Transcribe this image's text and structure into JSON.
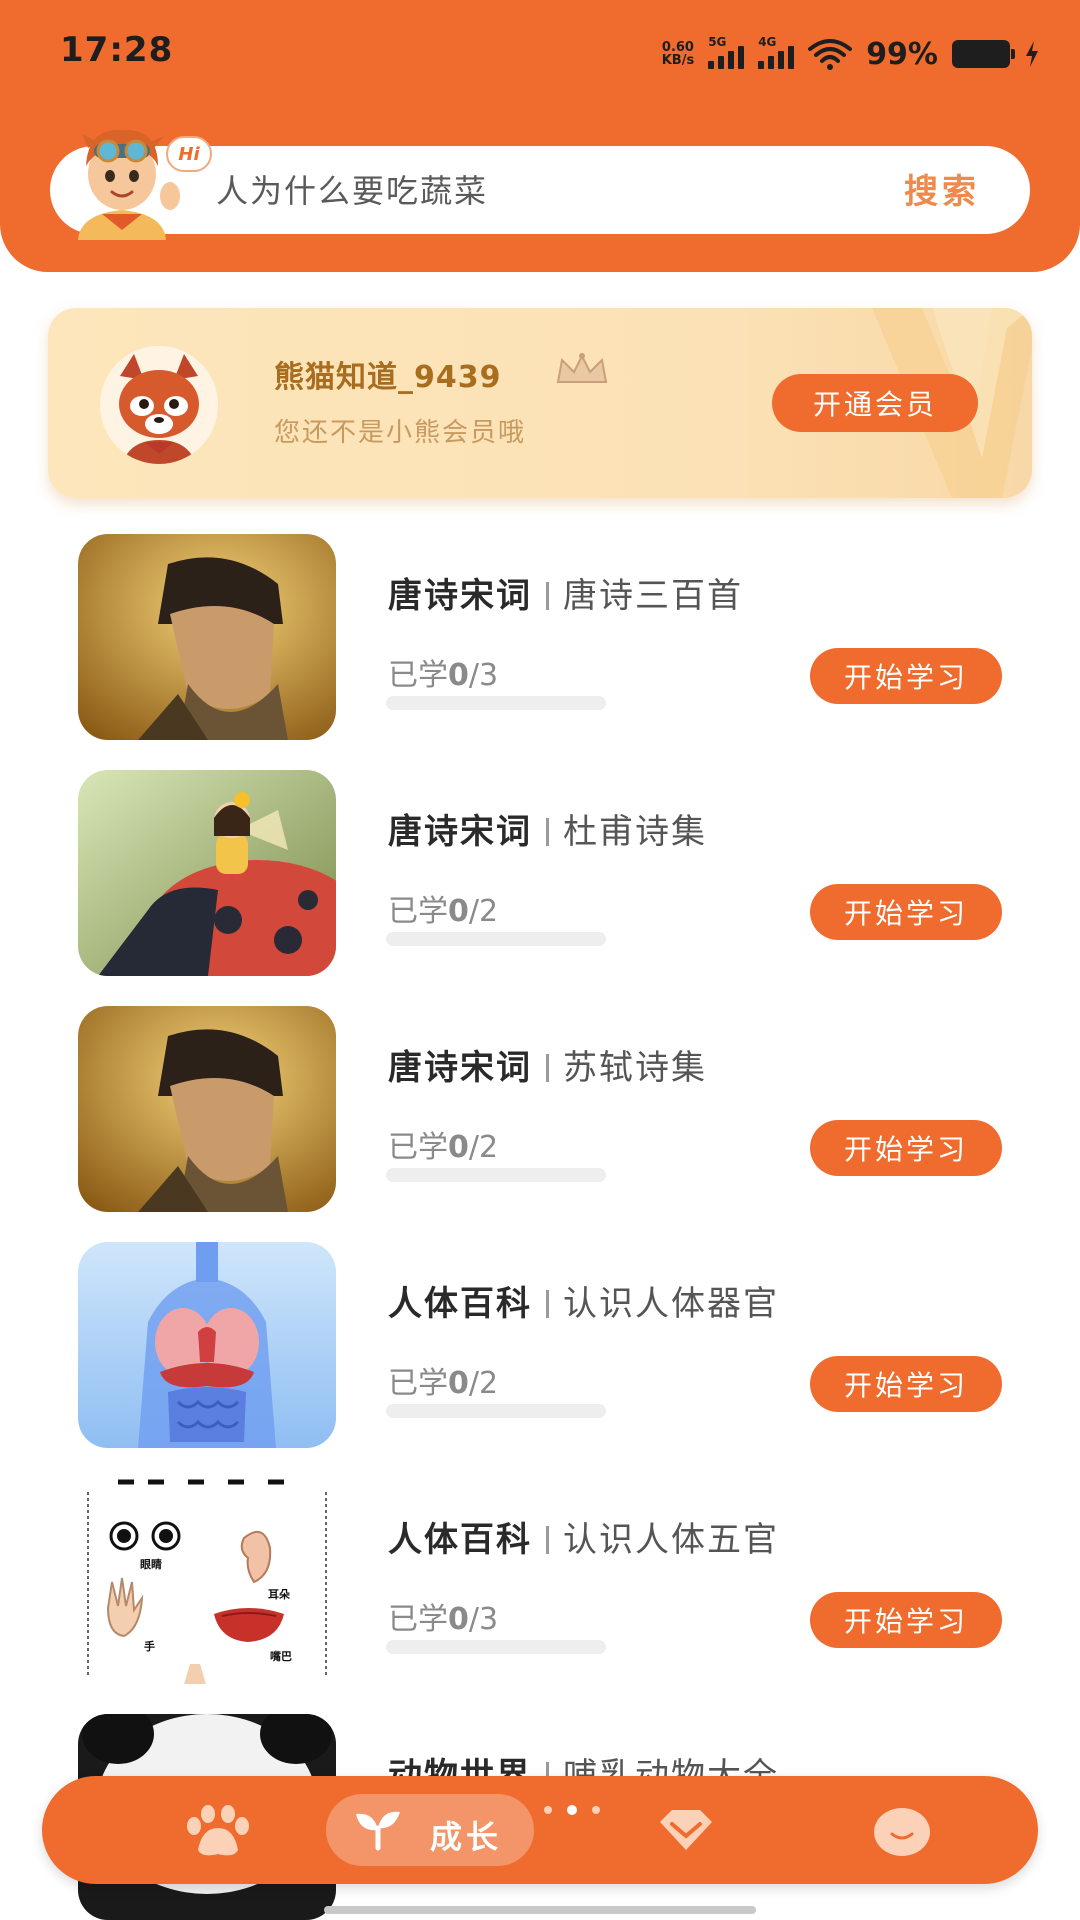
{
  "status_bar": {
    "time": "17:28",
    "net_speed_value": "0.60",
    "net_speed_unit": "KB/s",
    "sig1_label": "5G",
    "sig2_label": "4G",
    "battery_percent": "99%"
  },
  "search": {
    "hi_label": "Hi",
    "query": "人为什么要吃蔬菜",
    "button_label": "搜索"
  },
  "member": {
    "username": "熊猫知道_9439",
    "status": "您还不是小熊会员哦",
    "join_label": "开通会员"
  },
  "courses": [
    {
      "category": "唐诗宋词",
      "title": "唐诗三百首",
      "progress_label": "已学",
      "learned": "0",
      "total": "/3",
      "fraction": 0.0,
      "button": "开始学习",
      "thumb": "poet-portrait"
    },
    {
      "category": "唐诗宋词",
      "title": "杜甫诗集",
      "progress_label": "已学",
      "learned": "0",
      "total": "/2",
      "fraction": 0.0,
      "button": "开始学习",
      "thumb": "girl-on-ladybug"
    },
    {
      "category": "唐诗宋词",
      "title": "苏轼诗集",
      "progress_label": "已学",
      "learned": "0",
      "total": "/2",
      "fraction": 0.0,
      "button": "开始学习",
      "thumb": "poet-portrait"
    },
    {
      "category": "人体百科",
      "title": "认识人体器官",
      "progress_label": "已学",
      "learned": "0",
      "total": "/2",
      "fraction": 0.0,
      "button": "开始学习",
      "thumb": "human-anatomy"
    },
    {
      "category": "人体百科",
      "title": "认识人体五官",
      "progress_label": "已学",
      "learned": "0",
      "total": "/3",
      "fraction": 0.0,
      "button": "开始学习",
      "thumb": "five-senses-chart"
    },
    {
      "category": "动物世界",
      "title": "哺乳动物大全",
      "thumb": "panda"
    }
  ],
  "five_senses_labels": {
    "eyes": "眼睛",
    "ear": "耳朵",
    "hand": "手",
    "mouth": "嘴巴"
  },
  "bottom_nav": {
    "items": [
      "paw-icon",
      "sprout-icon",
      "gem-icon",
      "face-icon"
    ],
    "active_label": "成长"
  },
  "colors": {
    "brand": "#ef6c2e",
    "member_text": "#a86d1e"
  }
}
